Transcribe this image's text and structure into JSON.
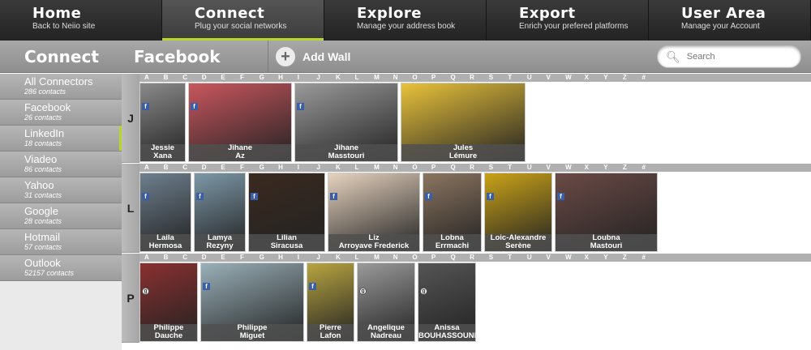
{
  "nav": [
    {
      "title": "Home",
      "sub": "Back to Neiio site"
    },
    {
      "title": "Connect",
      "sub": "Plug your social networks"
    },
    {
      "title": "Explore",
      "sub": "Manage your address book"
    },
    {
      "title": "Export",
      "sub": "Enrich your prefered platforms"
    },
    {
      "title": "User Area",
      "sub": "Manage your Account"
    }
  ],
  "toolbar": {
    "section": "Connect",
    "connector": "Facebook",
    "add_wall": "Add Wall",
    "search_placeholder": "Search"
  },
  "sidebar": [
    {
      "label": "All Connectors",
      "count": "286 contacts"
    },
    {
      "label": "Facebook",
      "count": "26 contacts"
    },
    {
      "label": "LinkedIn",
      "count": "18 contacts"
    },
    {
      "label": "Viadeo",
      "count": "86 contacts"
    },
    {
      "label": "Yahoo",
      "count": "31 contacts"
    },
    {
      "label": "Google",
      "count": "28 contacts"
    },
    {
      "label": "Hotmail",
      "count": "57 contacts"
    },
    {
      "label": "Outlook",
      "count": "52157 contacts"
    }
  ],
  "alphabet": [
    "A",
    "B",
    "C",
    "D",
    "E",
    "F",
    "G",
    "H",
    "I",
    "J",
    "K",
    "L",
    "M",
    "N",
    "O",
    "P",
    "Q",
    "R",
    "S",
    "T",
    "U",
    "V",
    "W",
    "X",
    "Y",
    "Z",
    "#"
  ],
  "groups": [
    {
      "letter": "J",
      "contacts": [
        {
          "first": "Jessie",
          "last": "Xana",
          "badge": "f",
          "color": "#8a8a8a"
        },
        {
          "first": "Jihane",
          "last": "Az",
          "badge": "f",
          "color": "#c9565e"
        },
        {
          "first": "Jihane",
          "last": "Masstouri",
          "badge": "f",
          "color": "#9a9a9a"
        },
        {
          "first": "Jules",
          "last": "Lémure",
          "badge": "",
          "color": "#e9c23a"
        }
      ]
    },
    {
      "letter": "L",
      "contacts": [
        {
          "first": "Laila",
          "last": "Hermosa",
          "badge": "f",
          "color": "#6e7f8e"
        },
        {
          "first": "Lamya",
          "last": "Rezyny",
          "badge": "f",
          "color": "#7d98a8"
        },
        {
          "first": "Lilian",
          "last": "Siracusa",
          "badge": "f",
          "color": "#3a2a20"
        },
        {
          "first": "Liz",
          "last": "Arroyave Frederick",
          "badge": "f",
          "color": "#e6d3bf"
        },
        {
          "first": "Lobna",
          "last": "Errmachi",
          "badge": "f",
          "color": "#8b7560"
        },
        {
          "first": "Loic-Alexandre",
          "last": "Serène",
          "badge": "f",
          "color": "#c9a218"
        },
        {
          "first": "Loubna",
          "last": "Mastouri",
          "badge": "f",
          "color": "#6a4a46"
        }
      ]
    },
    {
      "letter": "P",
      "contacts": [
        {
          "first": "Philippe",
          "last": "Dauche",
          "badge": "g",
          "color": "#8a3030"
        },
        {
          "first": "Philippe",
          "last": "Miguet",
          "badge": "f",
          "color": "#9ab0b8"
        },
        {
          "first": "Pierre",
          "last": "Lafon",
          "badge": "f",
          "color": "#b8a540"
        },
        {
          "first": "Angelique",
          "last": "Nadreau",
          "badge": "g",
          "color": "#9a9a9a"
        },
        {
          "first": "Anissa",
          "last": "BOUHASSOUNE",
          "badge": "g",
          "color": "#555"
        }
      ]
    }
  ]
}
